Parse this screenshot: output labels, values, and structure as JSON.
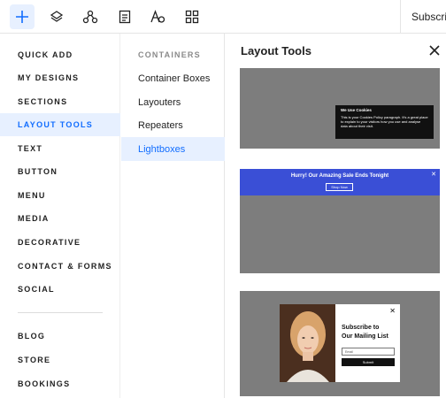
{
  "toolbar": {
    "buttons": [
      {
        "name": "add-icon",
        "active": true
      },
      {
        "name": "layers-icon"
      },
      {
        "name": "apps-icon"
      },
      {
        "name": "pages-icon"
      },
      {
        "name": "theme-icon"
      },
      {
        "name": "grid-icon"
      }
    ],
    "subscribe_label": "Subscrib"
  },
  "categories": {
    "items": [
      {
        "label": "QUICK ADD"
      },
      {
        "label": "MY DESIGNS"
      },
      {
        "label": "SECTIONS"
      },
      {
        "label": "LAYOUT TOOLS",
        "active": true
      },
      {
        "label": "TEXT"
      },
      {
        "label": "BUTTON"
      },
      {
        "label": "MENU"
      },
      {
        "label": "MEDIA"
      },
      {
        "label": "DECORATIVE"
      },
      {
        "label": "CONTACT & FORMS"
      },
      {
        "label": "SOCIAL"
      },
      {
        "label": "BLOG"
      },
      {
        "label": "STORE"
      },
      {
        "label": "BOOKINGS"
      }
    ]
  },
  "sub": {
    "heading": "CONTAINERS",
    "items": [
      {
        "label": "Container Boxes"
      },
      {
        "label": "Layouters"
      },
      {
        "label": "Repeaters"
      },
      {
        "label": "Lightboxes",
        "active": true
      }
    ]
  },
  "panel": {
    "title": "Layout Tools",
    "close_icon": "close-icon",
    "card1": {
      "cookie_title": "We Use Cookies",
      "cookie_body": "This is your Cookies Policy paragraph. It's a great place to explain to your visitors how you use and analyse data about their visit."
    },
    "card2": {
      "banner_text": "Hurry! Our Amazing Sale Ends Tonight",
      "banner_button": "Shop Now"
    },
    "card3": {
      "title_line1": "Subscribe to",
      "title_line2": "Our Mailing List",
      "email_placeholder": "Email",
      "submit_label": "Submit"
    }
  },
  "colors": {
    "accent": "#116dff",
    "active_bg": "#e7f0ff",
    "banner_blue": "#3a4fd6",
    "card_gray": "#7d7d7d"
  }
}
